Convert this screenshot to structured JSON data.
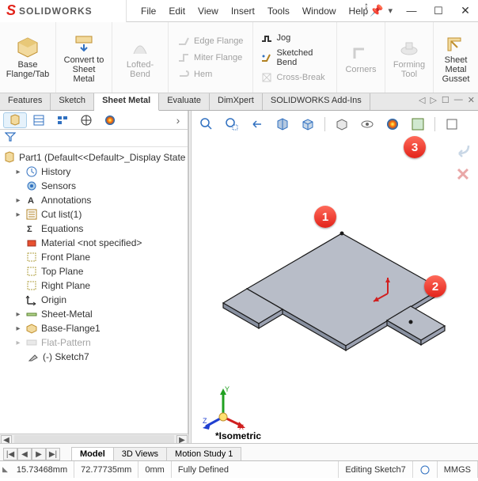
{
  "app": {
    "logo_prefix": "S",
    "logo_text": "SOLIDWORKS"
  },
  "menu": {
    "file": "File",
    "edit": "Edit",
    "view": "View",
    "insert": "Insert",
    "tools": "Tools",
    "window": "Window",
    "help": "Help"
  },
  "title_buttons": {
    "min": "—",
    "max": "☐",
    "close": "✕"
  },
  "ribbon": {
    "base_flange": "Base Flange/Tab",
    "convert": "Convert to Sheet Metal",
    "lofted_bend": "Lofted-Bend",
    "edge_flange": "Edge Flange",
    "miter_flange": "Miter Flange",
    "hem": "Hem",
    "jog": "Jog",
    "sketched_bend": "Sketched Bend",
    "cross_break": "Cross-Break",
    "corners": "Corners",
    "forming_tool": "Forming Tool",
    "gusset": "Sheet Metal Gusset"
  },
  "tabs": {
    "features": "Features",
    "sketch": "Sketch",
    "sheet_metal": "Sheet Metal",
    "evaluate": "Evaluate",
    "dimxpert": "DimXpert",
    "addins": "SOLIDWORKS Add-Ins"
  },
  "tree": {
    "part": "Part1  (Default<<Default>_Display State",
    "history": "History",
    "sensors": "Sensors",
    "annotations": "Annotations",
    "cutlist": "Cut list(1)",
    "equations": "Equations",
    "material": "Material <not specified>",
    "front": "Front Plane",
    "top": "Top Plane",
    "right": "Right Plane",
    "origin": "Origin",
    "sheetmetal": "Sheet-Metal",
    "baseflange": "Base-Flange1",
    "flatpattern": "Flat-Pattern",
    "sketch7": "(-) Sketch7"
  },
  "viewport": {
    "isometric": "*Isometric"
  },
  "bottom_tabs": {
    "model": "Model",
    "threed": "3D Views",
    "motion": "Motion Study 1"
  },
  "status": {
    "x": "15.73468mm",
    "y": "72.77735mm",
    "z": "0mm",
    "defined": "Fully Defined",
    "mode": "Editing Sketch7",
    "units": "MMGS"
  },
  "callouts": {
    "c1": "1",
    "c2": "2",
    "c3": "3"
  },
  "icons": {
    "pin": "📌",
    "dropdown": "▾",
    "drag": "↕"
  }
}
